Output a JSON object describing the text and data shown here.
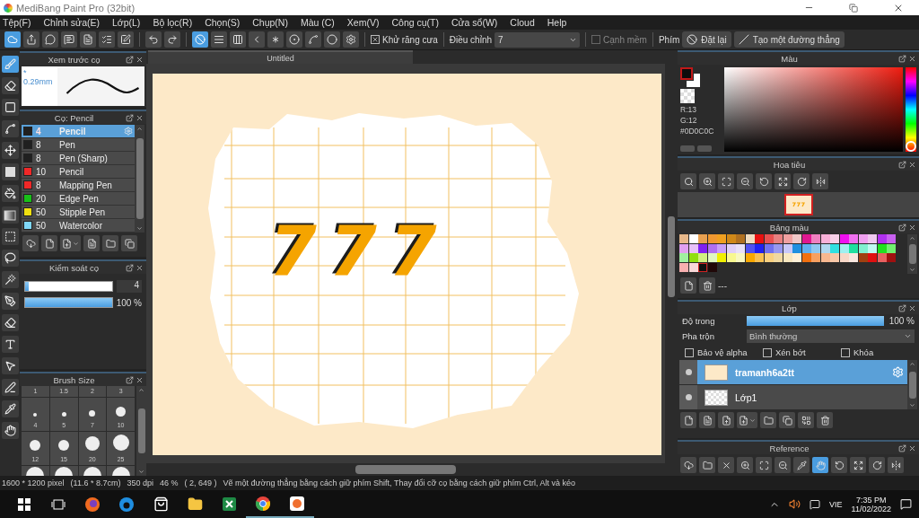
{
  "window": {
    "title": "MediBang Paint Pro (32bit)"
  },
  "menu": [
    "Tệp(F)",
    "Chỉnh sửa(E)",
    "Lớp(L)",
    "Bộ lọc(R)",
    "Chọn(S)",
    "Chụp(N)",
    "Màu (C)",
    "Xem(V)",
    "Công cụ(T)",
    "Cửa sổ(W)",
    "Cloud",
    "Help"
  ],
  "toolbar": {
    "snaps": [
      {
        "kind": "off",
        "selected": true
      },
      {
        "kind": "parallel",
        "selected": false
      },
      {
        "kind": "cross",
        "selected": false
      },
      {
        "kind": "vanish",
        "selected": false
      },
      {
        "kind": "radial",
        "selected": false
      },
      {
        "kind": "concentric",
        "selected": false
      },
      {
        "kind": "curve",
        "selected": false
      },
      {
        "kind": "ellipse",
        "selected": false
      },
      {
        "kind": "settings",
        "selected": false
      }
    ],
    "antialias": {
      "label": "Khử răng cưa",
      "checked": true
    },
    "correction": {
      "label": "Điều chỉnh",
      "value": "7"
    },
    "soft_edge": {
      "label": "Cạnh mềm",
      "checked": false
    },
    "keys_label": "Phím",
    "buttons": [
      {
        "kind": "reset",
        "label": "Đặt lại"
      },
      {
        "kind": "line",
        "label": "Tạo một đường thẳng"
      }
    ]
  },
  "tools": [
    {
      "kind": "brush",
      "selected": true
    },
    {
      "kind": "eraser",
      "selected": false
    },
    {
      "kind": "rect",
      "selected": false
    },
    {
      "kind": "polyline",
      "selected": false
    },
    {
      "kind": "move",
      "selected": false
    },
    {
      "kind": "fill",
      "selected": false
    },
    {
      "kind": "bucket",
      "selected": false
    },
    {
      "kind": "gradient",
      "selected": false
    },
    {
      "kind": "select",
      "selected": false
    },
    {
      "kind": "lasso",
      "selected": false
    },
    {
      "kind": "wand",
      "selected": false
    },
    {
      "kind": "selectpen",
      "selected": false
    },
    {
      "kind": "selecteraser",
      "selected": false
    },
    {
      "kind": "text",
      "selected": false
    },
    {
      "kind": "operation",
      "selected": false
    },
    {
      "kind": "pen",
      "selected": false
    },
    {
      "kind": "dropper",
      "selected": false
    },
    {
      "kind": "hand",
      "selected": false
    }
  ],
  "brush_preview": {
    "title": "Xem trước cọ",
    "size": "* 0.29mm"
  },
  "brush_panel": {
    "title": "Cọ: Pencil",
    "items": [
      {
        "color": "#202020",
        "size": "4",
        "name": "Pencil",
        "selected": true
      },
      {
        "color": "#202020",
        "size": "8",
        "name": "Pen",
        "selected": false
      },
      {
        "color": "#202020",
        "size": "8",
        "name": "Pen (Sharp)",
        "selected": false
      },
      {
        "color": "#f02828",
        "size": "10",
        "name": "Pencil",
        "selected": false
      },
      {
        "color": "#f02828",
        "size": "8",
        "name": "Mapping Pen",
        "selected": false
      },
      {
        "color": "#18c018",
        "size": "20",
        "name": "Edge Pen",
        "selected": false
      },
      {
        "color": "#f0e010",
        "size": "50",
        "name": "Stipple Pen",
        "selected": false
      },
      {
        "color": "#80d8f8",
        "size": "50",
        "name": "Watercolor",
        "selected": false
      }
    ]
  },
  "brush_control": {
    "title": "Kiểm soát cọ",
    "size": {
      "level": 0.04,
      "value": "4"
    },
    "opacity": {
      "level": 1,
      "value": "100 %"
    }
  },
  "brush_size": {
    "title": "Brush Size",
    "labels": [
      "1",
      "1.5",
      "2",
      "3",
      "4",
      "5",
      "7",
      "10",
      "12",
      "15",
      "20",
      "25"
    ]
  },
  "canvas": {
    "tab": "Untitled",
    "art_text": "777"
  },
  "color_panel": {
    "title": "Màu",
    "readout": [
      "R:13",
      "G:12"
    ],
    "hex": "#0D0C0C",
    "hue": {
      "level": 0
    }
  },
  "navigator": {
    "title": "Hoa tiêu"
  },
  "palette": {
    "title": "Bảng màu",
    "footer": "---",
    "swatches": [
      {
        "color": "#e8b88a",
        "selected": false
      },
      {
        "color": "#ffffff",
        "selected": false
      },
      {
        "color": "#e8a050",
        "selected": false
      },
      {
        "color": "#f09830",
        "selected": false
      },
      {
        "color": "#f0a020",
        "selected": false
      },
      {
        "color": "#d08818",
        "selected": false
      },
      {
        "color": "#b07020",
        "selected": false
      },
      {
        "color": "#f0dcc0",
        "selected": false
      },
      {
        "color": "#e81010",
        "selected": false
      },
      {
        "color": "#e85050",
        "selected": false
      },
      {
        "color": "#e88080",
        "selected": false
      },
      {
        "color": "#f0a0a0",
        "selected": false
      },
      {
        "color": "#f0c8c8",
        "selected": false
      },
      {
        "color": "#e01890",
        "selected": false
      },
      {
        "color": "#f080c0",
        "selected": false
      },
      {
        "color": "#f8b0d8",
        "selected": false
      },
      {
        "color": "#f8d0e8",
        "selected": false
      },
      {
        "color": "#f010f0",
        "selected": false
      },
      {
        "color": "#f070f0",
        "selected": false
      },
      {
        "color": "#f0a0f0",
        "selected": false
      },
      {
        "color": "#f0c8f0",
        "selected": false
      },
      {
        "color": "#b030f0",
        "selected": false
      },
      {
        "color": "#c860f0",
        "selected": false
      },
      {
        "color": "#e0a0f0",
        "selected": false
      },
      {
        "color": "#e8c0f8",
        "selected": false
      },
      {
        "color": "#8020f0",
        "selected": false
      },
      {
        "color": "#b070f0",
        "selected": false
      },
      {
        "color": "#c8a0f8",
        "selected": false
      },
      {
        "color": "#e0d0f8",
        "selected": false
      },
      {
        "color": "#e8e0f8",
        "selected": false
      },
      {
        "color": "#5050f0",
        "selected": false
      },
      {
        "color": "#2020f0",
        "selected": false
      },
      {
        "color": "#7070f0",
        "selected": false
      },
      {
        "color": "#9898f0",
        "selected": false
      },
      {
        "color": "#c8c8f8",
        "selected": false
      },
      {
        "color": "#2090e0",
        "selected": false
      },
      {
        "color": "#60b0f0",
        "selected": false
      },
      {
        "color": "#90c8f0",
        "selected": false
      },
      {
        "color": "#b0d8f0",
        "selected": false
      },
      {
        "color": "#30e0e0",
        "selected": false
      },
      {
        "color": "#a0f0f0",
        "selected": false
      },
      {
        "color": "#20e0a0",
        "selected": false
      },
      {
        "color": "#80f0d0",
        "selected": false
      },
      {
        "color": "#c0f8f0",
        "selected": false
      },
      {
        "color": "#20e020",
        "selected": false
      },
      {
        "color": "#70f070",
        "selected": false
      },
      {
        "color": "#a0f0a0",
        "selected": false
      },
      {
        "color": "#90e010",
        "selected": false
      },
      {
        "color": "#d0f080",
        "selected": false
      },
      {
        "color": "#e0f8c0",
        "selected": false
      },
      {
        "color": "#f0f000",
        "selected": false
      },
      {
        "color": "#f8f890",
        "selected": false
      },
      {
        "color": "#f8f8c0",
        "selected": false
      },
      {
        "color": "#f8a800",
        "selected": false
      },
      {
        "color": "#f8c050",
        "selected": false
      },
      {
        "color": "#f8d080",
        "selected": false
      },
      {
        "color": "#f0d8a0",
        "selected": false
      },
      {
        "color": "#f8e8c0",
        "selected": false
      },
      {
        "color": "#fff0d8",
        "selected": false
      },
      {
        "color": "#f07010",
        "selected": false
      },
      {
        "color": "#f8a060",
        "selected": false
      },
      {
        "color": "#f8b890",
        "selected": false
      },
      {
        "color": "#f8c8a8",
        "selected": false
      },
      {
        "color": "#f8d8c8",
        "selected": false
      },
      {
        "color": "#f8e8e0",
        "selected": false
      },
      {
        "color": "#a04010",
        "selected": false
      },
      {
        "color": "#e01010",
        "selected": false
      },
      {
        "color": "#e86060",
        "selected": false
      },
      {
        "color": "#a01010",
        "selected": false
      },
      {
        "color": "#f8b0b0",
        "selected": false
      },
      {
        "color": "#f8d8d8",
        "selected": false
      },
      {
        "color": "#101010",
        "selected": true
      },
      {
        "color": "#200808",
        "selected": false
      }
    ]
  },
  "layer_panel": {
    "title": "Lớp",
    "opacity": {
      "label": "Độ trong",
      "level": 1,
      "value": "100 %"
    },
    "blend": {
      "label": "Pha trộn",
      "value": "Bình thường"
    },
    "checks": [
      {
        "label": "Bảo vệ alpha",
        "checked": false
      },
      {
        "label": "Xén bớt",
        "checked": false
      },
      {
        "label": "Khóa",
        "checked": false
      }
    ],
    "layers": [
      {
        "name": "tramanh6a2tt",
        "selected": true
      },
      {
        "name": "Lớp1",
        "selected": false
      }
    ]
  },
  "reference": {
    "title": "Reference",
    "tools": [
      {
        "kind": "cloud",
        "selected": false
      },
      {
        "kind": "folder",
        "selected": false
      },
      {
        "kind": "clear",
        "selected": false
      },
      {
        "kind": "zoomin",
        "selected": false
      },
      {
        "kind": "fit",
        "selected": false
      },
      {
        "kind": "zoomout",
        "selected": false
      },
      {
        "kind": "dropper",
        "selected": false
      },
      {
        "kind": "hand",
        "selected": true
      },
      {
        "kind": "rotl",
        "selected": false
      },
      {
        "kind": "reset",
        "selected": false
      },
      {
        "kind": "rotr",
        "selected": false
      },
      {
        "kind": "flip",
        "selected": false
      }
    ]
  },
  "status_bar": [
    "1600 * 1200 pixel",
    "(11.6 * 8.7cm)",
    "350 dpi",
    "46 %",
    "( 2, 649 )",
    "Vẽ một đường thẳng bằng cách giữ phím Shift, Thay đổi cỡ cọ bằng cách giữ phím Ctrl, Alt và kéo"
  ],
  "taskbar": {
    "language": "VIE",
    "time": "7:35 PM",
    "date": "11/02/2022"
  }
}
